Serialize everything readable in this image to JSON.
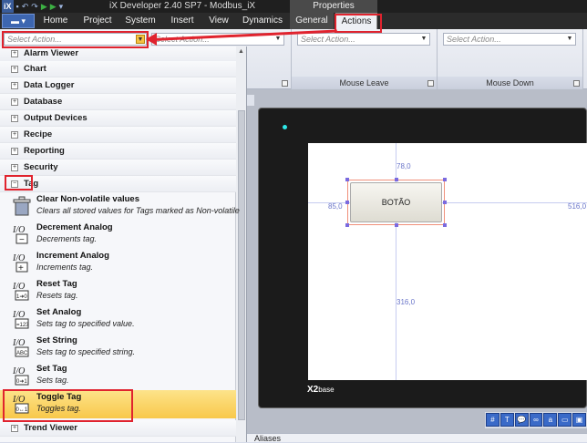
{
  "title_bar": {
    "app_title": "iX Developer 2.40 SP7 - Modbus_iX",
    "context_label": "Properties",
    "logo": "iX"
  },
  "tabs": [
    "Home",
    "Project",
    "System",
    "Insert",
    "View",
    "Dynamics",
    "General",
    "Actions"
  ],
  "ribbon": {
    "combo_placeholder": "Select Action...",
    "groups": [
      "Mouse Leave",
      "Mouse Down"
    ]
  },
  "categories_top": [
    "Alarm Viewer",
    "Chart",
    "Data Logger",
    "Database",
    "Output Devices",
    "Recipe",
    "Reporting",
    "Security",
    "Tag"
  ],
  "tag_actions": [
    {
      "name": "Clear Non-volatile values",
      "desc": "Clears all stored values for Tags marked as Non-volatile",
      "icon": "clear-icon"
    },
    {
      "name": "Decrement Analog",
      "desc": "Decrements tag.",
      "icon": "decrement-icon"
    },
    {
      "name": "Increment Analog",
      "desc": "Increments tag.",
      "icon": "increment-icon"
    },
    {
      "name": "Reset Tag",
      "desc": "Resets tag.",
      "icon": "reset-icon"
    },
    {
      "name": "Set Analog",
      "desc": "Sets tag to specified value.",
      "icon": "set-analog-icon"
    },
    {
      "name": "Set String",
      "desc": "Sets tag to specified string.",
      "icon": "set-string-icon"
    },
    {
      "name": "Set Tag",
      "desc": "Sets tag.",
      "icon": "set-tag-icon"
    },
    {
      "name": "Toggle Tag",
      "desc": "Toggles tag.",
      "icon": "toggle-icon"
    }
  ],
  "categories_bottom": [
    "Trend Viewer"
  ],
  "canvas": {
    "button_text": "BOTÃO",
    "dim_top": "78,0",
    "dim_left": "85,0",
    "dim_right": "516,0",
    "dim_bottom": "316,0",
    "device_brand": "X2",
    "device_model": "base"
  },
  "bottom_panel": "Aliases",
  "colors": {
    "highlight": "#e0232e",
    "selection": "#f8c84a"
  }
}
